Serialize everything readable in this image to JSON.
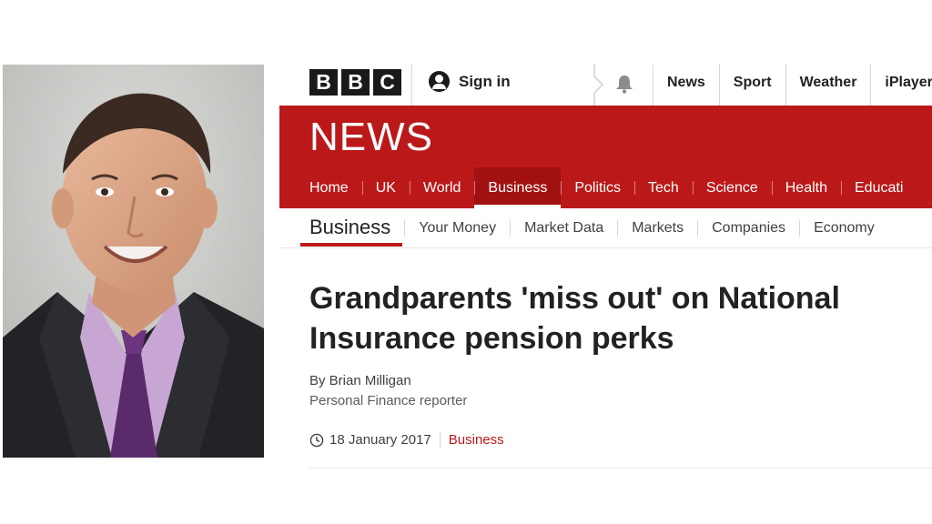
{
  "photo": {
    "alt": "Portrait photo of a smiling man in a dark suit and purple tie"
  },
  "masthead": {
    "logo_letters": [
      "B",
      "B",
      "C"
    ],
    "sign_in_label": "Sign in",
    "links": [
      "News",
      "Sport",
      "Weather",
      "iPlayer"
    ]
  },
  "news_band": {
    "wordmark": "NEWS",
    "nav": [
      "Home",
      "UK",
      "World",
      "Business",
      "Politics",
      "Tech",
      "Science",
      "Health",
      "Educati"
    ],
    "active": "Business"
  },
  "section_nav": {
    "title": "Business",
    "links": [
      "Your Money",
      "Market Data",
      "Markets",
      "Companies",
      "Economy"
    ]
  },
  "article": {
    "headline": "Grandparents 'miss out' on National Insurance pension perks",
    "author": "By Brian Milligan",
    "author_role": "Personal Finance reporter",
    "date": "18 January 2017",
    "section": "Business"
  },
  "colors": {
    "bbc_red": "#bb1919",
    "active_tab": "#a21111",
    "text": "#222222"
  },
  "icons": [
    "user-icon",
    "chevron-right-icon",
    "bell-icon",
    "clock-icon"
  ]
}
